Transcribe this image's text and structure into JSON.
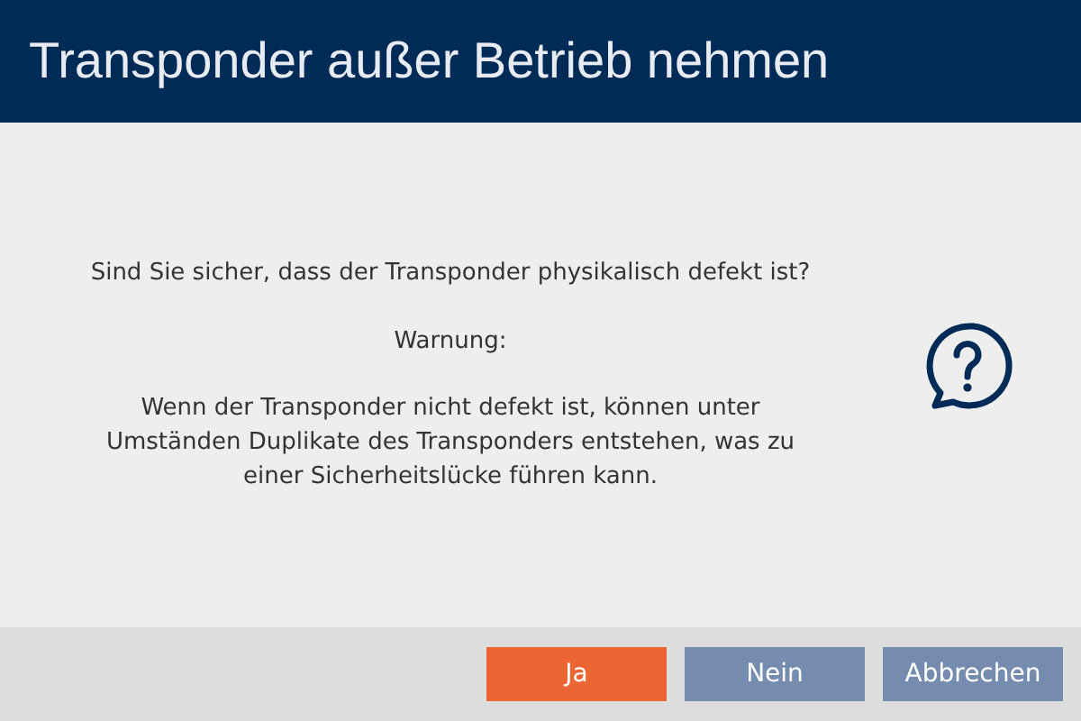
{
  "window": {
    "title": "Transponder außer Betrieb nehmen"
  },
  "message": {
    "question": "Sind Sie sicher, dass der Transponder physikalisch defekt ist?",
    "warning_label": "Warnung:",
    "warning_text": "Wenn der Transponder nicht defekt ist, können unter Umständen Duplikate des Transponders entstehen, was zu einer Sicherheitslücke führen kann."
  },
  "buttons": [
    {
      "label": "Ja",
      "kind": "primary"
    },
    {
      "label": "Nein",
      "kind": "secondary"
    },
    {
      "label": "Abbrechen",
      "kind": "secondary"
    }
  ]
}
